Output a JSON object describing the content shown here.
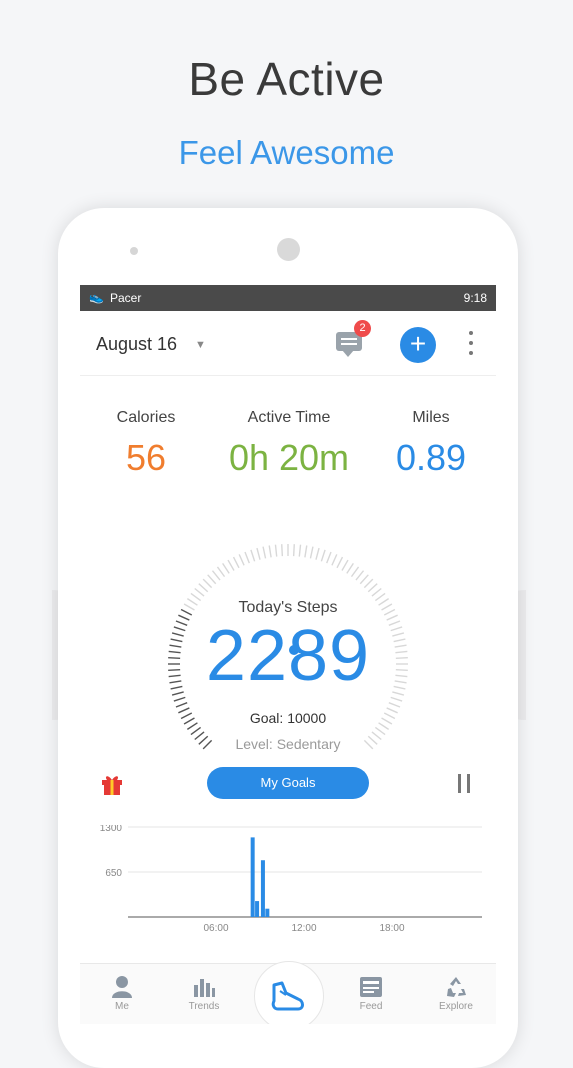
{
  "hero": {
    "title": "Be Active",
    "subtitle": "Feel Awesome"
  },
  "status_bar": {
    "app_name": "Pacer",
    "time": "9:18"
  },
  "app_bar": {
    "date": "August 16",
    "message_badge": "2",
    "add_icon": "plus-icon",
    "more_icon": "more-vert-icon"
  },
  "stats": [
    {
      "label": "Calories",
      "value": "56",
      "color": "#f07d2e"
    },
    {
      "label": "Active Time",
      "value": "0h 20m",
      "color": "#7cb342"
    },
    {
      "label": "Miles",
      "value": "0.89",
      "color": "#2a8be5"
    }
  ],
  "steps": {
    "label": "Today's Steps",
    "value": "2289",
    "goal": "Goal: 10000",
    "level": "Level: Sedentary",
    "progress": 0.2289
  },
  "actions": {
    "goals_button": "My Goals",
    "gift_icon": "gift-icon",
    "pause_icon": "pause-icon"
  },
  "chart_data": {
    "type": "bar",
    "ylim": [
      0,
      1300
    ],
    "yticks": [
      "1300",
      "650"
    ],
    "xticks": [
      "06:00",
      "12:00",
      "18:00"
    ],
    "x_hours": [
      8.5,
      8.8,
      9.2,
      9.5
    ],
    "values": [
      1150,
      230,
      820,
      120
    ],
    "color": "#2a8be5"
  },
  "nav": [
    {
      "label": "Me",
      "icon": "person-icon"
    },
    {
      "label": "Trends",
      "icon": "bar-chart-icon"
    },
    {
      "label": "",
      "icon": "shoe-icon"
    },
    {
      "label": "Feed",
      "icon": "feed-icon"
    },
    {
      "label": "Explore",
      "icon": "recycle-icon"
    }
  ],
  "colors": {
    "accent": "#2a8be5",
    "badge": "#ef4b4b",
    "statusbar": "#4a4a4a"
  }
}
